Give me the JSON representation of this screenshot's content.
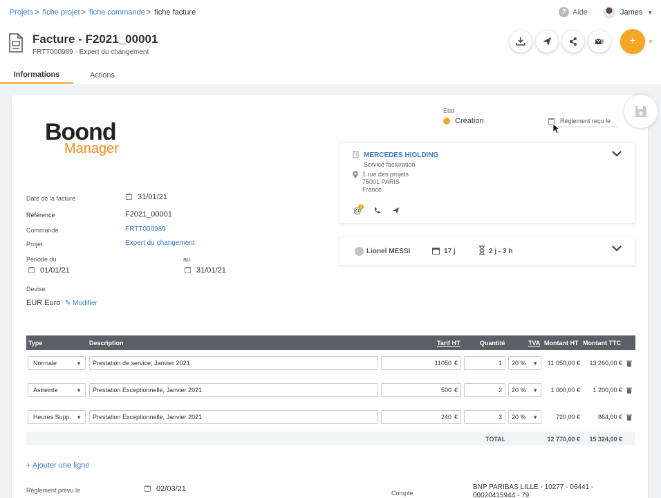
{
  "breadcrumb": {
    "items": [
      "Projets",
      "fiche projet",
      "fiche commande"
    ],
    "current": "fiche facture",
    "separator": ">"
  },
  "header": {
    "help_label": "Aide",
    "user_name": "James",
    "title": "Facture - F2021_00001",
    "subtitle": "FRTT000989 - Expert du changement",
    "plus_label": "+"
  },
  "tabs": [
    {
      "label": "Informations",
      "active": true
    },
    {
      "label": "Actions",
      "active": false
    }
  ],
  "logo": {
    "line1": "Boond",
    "line2": "Manager"
  },
  "status": {
    "label": "Etat",
    "value": "Création",
    "color": "#f5a623",
    "reglement_label": "Règlement reçu le"
  },
  "form": {
    "date_label": "Date de la facture",
    "date_value": "31/01/21",
    "reference_label": "Référence",
    "reference_value": "F2021_00001",
    "commande_label": "Commande",
    "commande_value": "FRTT000989",
    "projet_label": "Projet",
    "projet_value": "Expert du changement",
    "periode_label": "Période du",
    "periode_from": "01/01/21",
    "au_label": "au",
    "periode_to": "31/01/21",
    "devise_label": "Devise",
    "devise_value": "EUR Euro",
    "modifier_label": "Modifier"
  },
  "client": {
    "name": "MERCEDES HIOLDING",
    "service": "Service facturation",
    "address1": "1 rue des projets",
    "address2": "75001 PARIS",
    "country": "France",
    "badge": "1"
  },
  "resource": {
    "name": "Lionel MESSI",
    "days": "17 j",
    "duration": "2 j - 3 h"
  },
  "table": {
    "headers": {
      "type": "Type",
      "description": "Description",
      "tarif": "Tarif HT",
      "quantite": "Quantité",
      "tva": "TVA",
      "montant_ht": "Montant HT",
      "montant_ttc": "Montant TTC"
    },
    "rows": [
      {
        "type": "Normale",
        "description": "Prestation de service, Janvier 2021",
        "tarif": "11050",
        "quantite": "1",
        "tva": "20 %",
        "montant_ht": "11 050,00 €",
        "montant_ttc": "13 260,00 €"
      },
      {
        "type": "Astreinte",
        "description": "Prestation Exceptionnelle, Janvier 2021",
        "tarif": "500",
        "quantite": "2",
        "tva": "20 %",
        "montant_ht": "1 000,00 €",
        "montant_ttc": "1 200,00 €"
      },
      {
        "type": "Heures Supp.",
        "description": "Prestation Exceptionnelle, Janvier 2021",
        "tarif": "240",
        "quantite": "3",
        "tva": "20 %",
        "montant_ht": "720,00 €",
        "montant_ttc": "864,00 €"
      }
    ],
    "currency": "€",
    "total_label": "TOTAL",
    "total_ht": "12 770,00 €",
    "total_ttc": "15 324,00 €",
    "add_line": "+ Ajouter une ligne"
  },
  "footer": {
    "reglement_prevu_label": "Règlement prévu le",
    "reglement_prevu_value": "02/03/21",
    "compte_label": "Compte",
    "compte_value_1": "BNP PARIBAS LILLE - 10277 - 06441 -",
    "compte_value_2": "00020415944 - 79"
  },
  "colors": {
    "accent": "#f5a623",
    "link": "#3a7bc8",
    "table_header": "#5b5f66"
  }
}
